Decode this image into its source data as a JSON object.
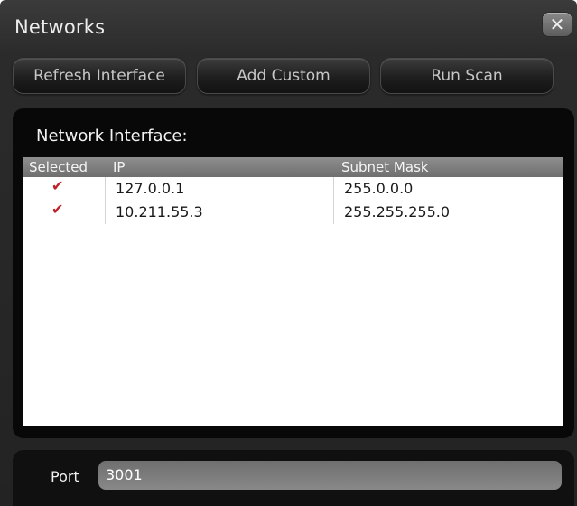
{
  "window": {
    "title": "Networks",
    "close_icon": "close-icon",
    "close_glyph": "✕"
  },
  "toolbar": {
    "refresh_label": "Refresh Interface",
    "add_custom_label": "Add Custom",
    "run_scan_label": "Run Scan"
  },
  "network_panel": {
    "title": "Network Interface:",
    "columns": [
      "Selected",
      "IP",
      "Subnet Mask"
    ],
    "rows": [
      {
        "selected": true,
        "selected_glyph": "✔",
        "ip": "127.0.0.1",
        "subnet_mask": "255.0.0.0"
      },
      {
        "selected": true,
        "selected_glyph": "✔",
        "ip": "10.211.55.3",
        "subnet_mask": "255.255.255.0"
      }
    ]
  },
  "port": {
    "label": "Port",
    "value": "3001"
  },
  "colors": {
    "check_red": "#c0202a",
    "panel_black": "#080808",
    "header_gray": "#7f7f7f"
  }
}
